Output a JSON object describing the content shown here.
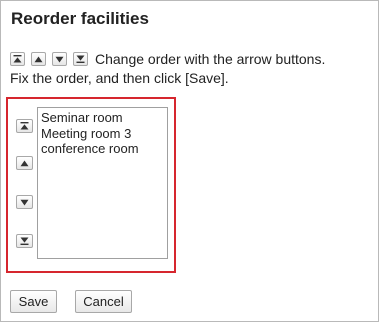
{
  "dialog": {
    "title": "Reorder facilities",
    "instruction_line1": "Change order with the arrow buttons.",
    "instruction_line2": "Fix the order, and then click [Save]."
  },
  "legend_icons": [
    "move-top-icon",
    "move-up-icon",
    "move-down-icon",
    "move-bottom-icon"
  ],
  "order_controls": [
    {
      "name": "move-to-top-button",
      "icon": "move-top-icon"
    },
    {
      "name": "move-up-button",
      "icon": "move-up-icon"
    },
    {
      "name": "move-down-button",
      "icon": "move-down-icon"
    },
    {
      "name": "move-to-bottom-button",
      "icon": "move-bottom-icon"
    }
  ],
  "facilities": [
    "Seminar room",
    "Meeting room 3",
    "conference room"
  ],
  "buttons": {
    "save": "Save",
    "cancel": "Cancel"
  },
  "colors": {
    "highlight_border": "#d6262e",
    "frame_border": "#b9b9b9"
  }
}
